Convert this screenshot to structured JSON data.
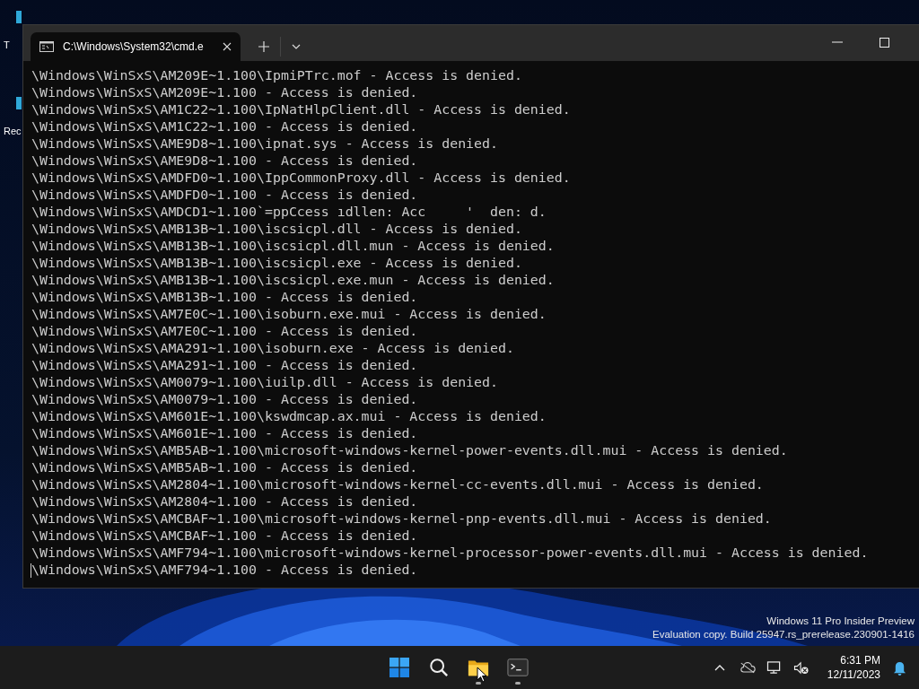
{
  "desktop": {
    "icons": [
      {
        "label": "T"
      },
      {
        "label": "Rec"
      }
    ],
    "edition_notice": [
      "Windows 11 Pro Insider Preview",
      "Evaluation copy. Build 25947.rs_prerelease.230901-1416"
    ]
  },
  "window": {
    "tabs": [
      {
        "title": "C:\\Windows\\System32\\cmd.e",
        "selected": true
      }
    ]
  },
  "console": {
    "lines": [
      "\\Windows\\WinSxS\\AM209E~1.100\\IpmiPTrc.mof - Access is denied.",
      "\\Windows\\WinSxS\\AM209E~1.100 - Access is denied.",
      "\\Windows\\WinSxS\\AM1C22~1.100\\IpNatHlpClient.dll - Access is denied.",
      "\\Windows\\WinSxS\\AM1C22~1.100 - Access is denied.",
      "\\Windows\\WinSxS\\AME9D8~1.100\\ipnat.sys - Access is denied.",
      "\\Windows\\WinSxS\\AME9D8~1.100 - Access is denied.",
      "\\Windows\\WinSxS\\AMDFD0~1.100\\IppCommonProxy.dll - Access is denied.",
      "\\Windows\\WinSxS\\AMDFD0~1.100 - Access is denied.",
      "\\Windows\\WinSxS\\AMDCD1~1.100`=ppCcess ıdllen: Acc     '  den: d.",
      "\\Windows\\WinSxS\\AMB13B~1.100\\iscsicpl.dll - Access is denied.",
      "\\Windows\\WinSxS\\AMB13B~1.100\\iscsicpl.dll.mun - Access is denied.",
      "\\Windows\\WinSxS\\AMB13B~1.100\\iscsicpl.exe - Access is denied.",
      "\\Windows\\WinSxS\\AMB13B~1.100\\iscsicpl.exe.mun - Access is denied.",
      "\\Windows\\WinSxS\\AMB13B~1.100 - Access is denied.",
      "\\Windows\\WinSxS\\AM7E0C~1.100\\isoburn.exe.mui - Access is denied.",
      "\\Windows\\WinSxS\\AM7E0C~1.100 - Access is denied.",
      "\\Windows\\WinSxS\\AMA291~1.100\\isoburn.exe - Access is denied.",
      "\\Windows\\WinSxS\\AMA291~1.100 - Access is denied.",
      "\\Windows\\WinSxS\\AM0079~1.100\\iuilp.dll - Access is denied.",
      "\\Windows\\WinSxS\\AM0079~1.100 - Access is denied.",
      "\\Windows\\WinSxS\\AM601E~1.100\\kswdmcap.ax.mui - Access is denied.",
      "\\Windows\\WinSxS\\AM601E~1.100 - Access is denied.",
      "\\Windows\\WinSxS\\AMB5AB~1.100\\microsoft-windows-kernel-power-events.dll.mui - Access is denied.",
      "\\Windows\\WinSxS\\AMB5AB~1.100 - Access is denied.",
      "\\Windows\\WinSxS\\AM2804~1.100\\microsoft-windows-kernel-cc-events.dll.mui - Access is denied.",
      "\\Windows\\WinSxS\\AM2804~1.100 - Access is denied.",
      "\\Windows\\WinSxS\\AMCBAF~1.100\\microsoft-windows-kernel-pnp-events.dll.mui - Access is denied.",
      "\\Windows\\WinSxS\\AMCBAF~1.100 - Access is denied.",
      "\\Windows\\WinSxS\\AMF794~1.100\\microsoft-windows-kernel-processor-power-events.dll.mui - Access is denied.",
      "\\Windows\\WinSxS\\AMF794~1.100 - Access is denied."
    ]
  },
  "taskbar": {
    "apps": [
      {
        "kind": "start",
        "running": false
      },
      {
        "kind": "search",
        "running": false
      },
      {
        "kind": "folder",
        "running": true
      },
      {
        "kind": "terminal",
        "running": true
      }
    ],
    "clock": {
      "time": "6:31 PM",
      "date": "12/11/2023"
    }
  }
}
